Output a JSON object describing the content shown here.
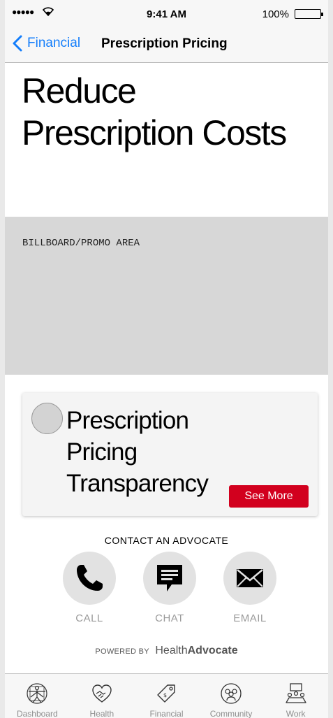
{
  "status_bar": {
    "signal": "●●●●●",
    "time": "9:41 AM",
    "battery": "100%"
  },
  "nav": {
    "back_label": "Financial",
    "title": "Prescription Pricing"
  },
  "hero": {
    "title": "Reduce Prescription Costs"
  },
  "billboard": {
    "label": "BILLBOARD/PROMO AREA"
  },
  "card": {
    "title": "Prescription Pricing Transparency",
    "button_label": "See More"
  },
  "contact": {
    "heading": "CONTACT AN ADVOCATE",
    "buttons": [
      {
        "label": "CALL",
        "icon": "phone-icon"
      },
      {
        "label": "CHAT",
        "icon": "chat-icon"
      },
      {
        "label": "EMAIL",
        "icon": "email-icon"
      }
    ]
  },
  "powered": {
    "prefix": "POWERED BY",
    "brand_light": "Health",
    "brand_bold": "Advocate"
  },
  "tabs": [
    {
      "label": "Dashboard",
      "icon": "vitruvian-man-icon"
    },
    {
      "label": "Health",
      "icon": "heart-handshake-icon"
    },
    {
      "label": "Financial",
      "icon": "price-tag-icon"
    },
    {
      "label": "Community",
      "icon": "people-group-icon"
    },
    {
      "label": "Work",
      "icon": "meeting-table-icon"
    }
  ],
  "colors": {
    "accent": "#147efb",
    "cta": "#d2001e",
    "billboard": "#d7d7d7"
  }
}
